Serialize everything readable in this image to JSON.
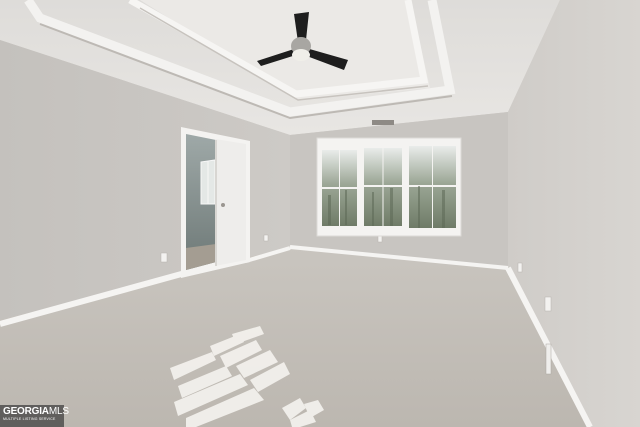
{
  "watermark": {
    "brand_strong": "GEORGIA",
    "brand_light": "MLS",
    "tagline": "MULTIPLE LISTING SERVICE"
  },
  "colors": {
    "wall_left": "#c9c6c2",
    "wall_back": "#c6c3bf",
    "wall_right": "#d2cfcb",
    "ceiling": "#e6e4e1",
    "carpet": "#c2beb8",
    "trim": "#f4f3f1",
    "fan_blade": "#1e1e1e",
    "window_glass": "#8f9b8d"
  }
}
